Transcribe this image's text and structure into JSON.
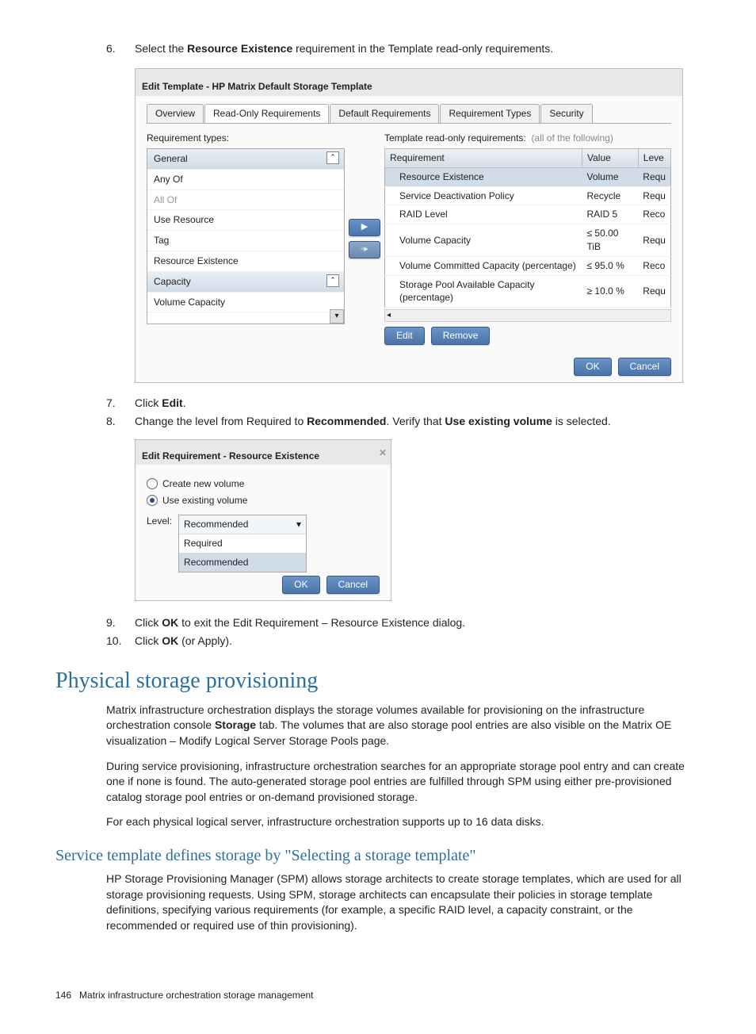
{
  "steps1": {
    "n6_num": "6.",
    "n6_a": "Select the ",
    "n6_b": "Resource Existence",
    "n6_c": " requirement in the Template read-only requirements."
  },
  "et": {
    "title": "Edit Template - HP Matrix Default Storage Template",
    "tabs": [
      "Overview",
      "Read-Only Requirements",
      "Default Requirements",
      "Requirement Types",
      "Security"
    ],
    "left_label": "Requirement types:",
    "left_items": [
      {
        "label": "General",
        "header": true,
        "collapsible": true
      },
      {
        "label": "Any Of"
      },
      {
        "label": "All Of",
        "disabled": true
      },
      {
        "label": "Use Resource"
      },
      {
        "label": "Tag"
      },
      {
        "label": "Resource Existence"
      },
      {
        "label": "Capacity",
        "header": true,
        "collapsible": true
      },
      {
        "label": "Volume Capacity"
      }
    ],
    "right_label_a": "Template read-only requirements:",
    "right_label_b": "(all of the following)",
    "columns": [
      "Requirement",
      "Value",
      "Leve"
    ],
    "rows": [
      {
        "req": "Resource Existence",
        "val": "Volume",
        "lvl": "Requ",
        "selected": true
      },
      {
        "req": "Service Deactivation Policy",
        "val": "Recycle",
        "lvl": "Requ"
      },
      {
        "req": "RAID Level",
        "val": "RAID 5",
        "lvl": "Reco"
      },
      {
        "req": "Volume Capacity",
        "val": "≤ 50.00 TiB",
        "lvl": "Requ"
      },
      {
        "req": "Volume Committed Capacity (percentage)",
        "val": "≤ 95.0 %",
        "lvl": "Reco"
      },
      {
        "req": "Storage Pool Available Capacity (percentage)",
        "val": "≥ 10.0 %",
        "lvl": "Requ"
      }
    ],
    "edit_btn": "Edit",
    "remove_btn": "Remove",
    "ok_btn": "OK",
    "cancel_btn": "Cancel"
  },
  "steps2": {
    "n7_num": "7.",
    "n7_a": "Click ",
    "n7_b": "Edit",
    "n7_c": ".",
    "n8_num": "8.",
    "n8_a": "Change the level from Required to ",
    "n8_b": "Recommended",
    "n8_c": ". Verify that ",
    "n8_d": "Use existing volume",
    "n8_e": " is selected."
  },
  "er": {
    "title": "Edit Requirement - Resource Existence",
    "opt1": "Create new volume",
    "opt2": "Use existing volume",
    "level_label": "Level:",
    "selected": "Recommended",
    "options": [
      "Required",
      "Recommended"
    ],
    "ok_btn": "OK",
    "cancel_btn": "Cancel"
  },
  "steps3": {
    "n9_num": "9.",
    "n9_a": "Click ",
    "n9_b": "OK",
    "n9_c": " to exit the Edit Requirement – Resource Existence dialog.",
    "n10_num": "10.",
    "n10_a": "Click ",
    "n10_b": "OK",
    "n10_c": " (or Apply)."
  },
  "h1": "Physical storage provisioning",
  "p1_a": "Matrix infrastructure orchestration displays the storage volumes available for provisioning on the infrastructure orchestration console ",
  "p1_b": "Storage",
  "p1_c": " tab. The volumes that are also storage pool entries are also visible on the Matrix OE visualization – Modify Logical Server Storage Pools page.",
  "p2": "During service provisioning, infrastructure orchestration searches for an appropriate storage pool entry and can create one if none is found. The auto-generated storage pool entries are fulfilled through SPM using either pre-provisioned catalog storage pool entries or on-demand provisioned storage.",
  "p3": "For each physical logical server, infrastructure orchestration supports up to 16 data disks.",
  "h2": "Service template defines storage by \"Selecting a storage template\"",
  "p4": "HP Storage Provisioning Manager (SPM) allows storage architects to create storage templates, which are used for all storage provisioning requests. Using SPM, storage architects can encapsulate their policies in storage template definitions, specifying various requirements (for example, a specific RAID level, a capacity constraint, or the recommended or required use of thin provisioning).",
  "footer": {
    "page": "146",
    "text": "Matrix infrastructure orchestration storage management"
  }
}
